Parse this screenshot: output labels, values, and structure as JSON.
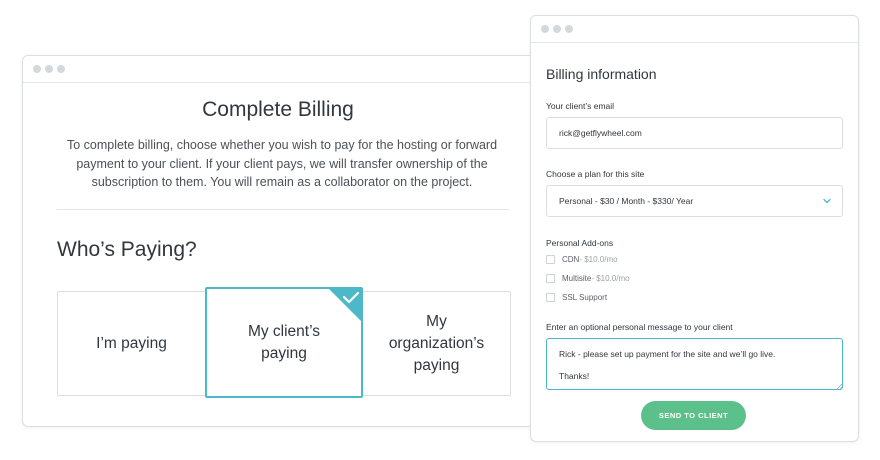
{
  "billing_page": {
    "title": "Complete Billing",
    "description": "To complete billing, choose whether you wish to pay for the hosting or forward payment to your client. If your client pays, we will transfer ownership of the subscription to them. You will remain as a collaborator on the project.",
    "who_paying_heading": "Who’s Paying?",
    "options": [
      {
        "label": "I’m paying",
        "selected": false
      },
      {
        "label": "My client’s\npaying",
        "selected": true
      },
      {
        "label": "My\norganization’s\npaying",
        "selected": false
      }
    ]
  },
  "billing_info": {
    "heading": "Billing information",
    "email_label": "Your client’s email",
    "email_value": "rick@getflywheel.com",
    "plan_label": "Choose a plan for this site",
    "plan_value": "Personal - $30 / Month - $330/ Year",
    "addons_label": "Personal Add-ons",
    "addons": [
      {
        "name": "CDN",
        "price": " - $10.0/mo"
      },
      {
        "name": "Multisite",
        "price": " - $10.0/mo"
      },
      {
        "name": "SSL Support",
        "price": ""
      }
    ],
    "message_label": "Enter an optional personal message to your client",
    "message_value": "Rick - please set up payment for the site and we’ll go live.\n\nThanks!",
    "send_button": "SEND TO CLIENT"
  },
  "colors": {
    "accent": "#4cb8c8",
    "button": "#5cc08a",
    "border": "#dcdfe2"
  },
  "icons": [
    "window-dots-icon",
    "checkmark-icon",
    "chevron-down-icon",
    "resize-grip-icon"
  ]
}
